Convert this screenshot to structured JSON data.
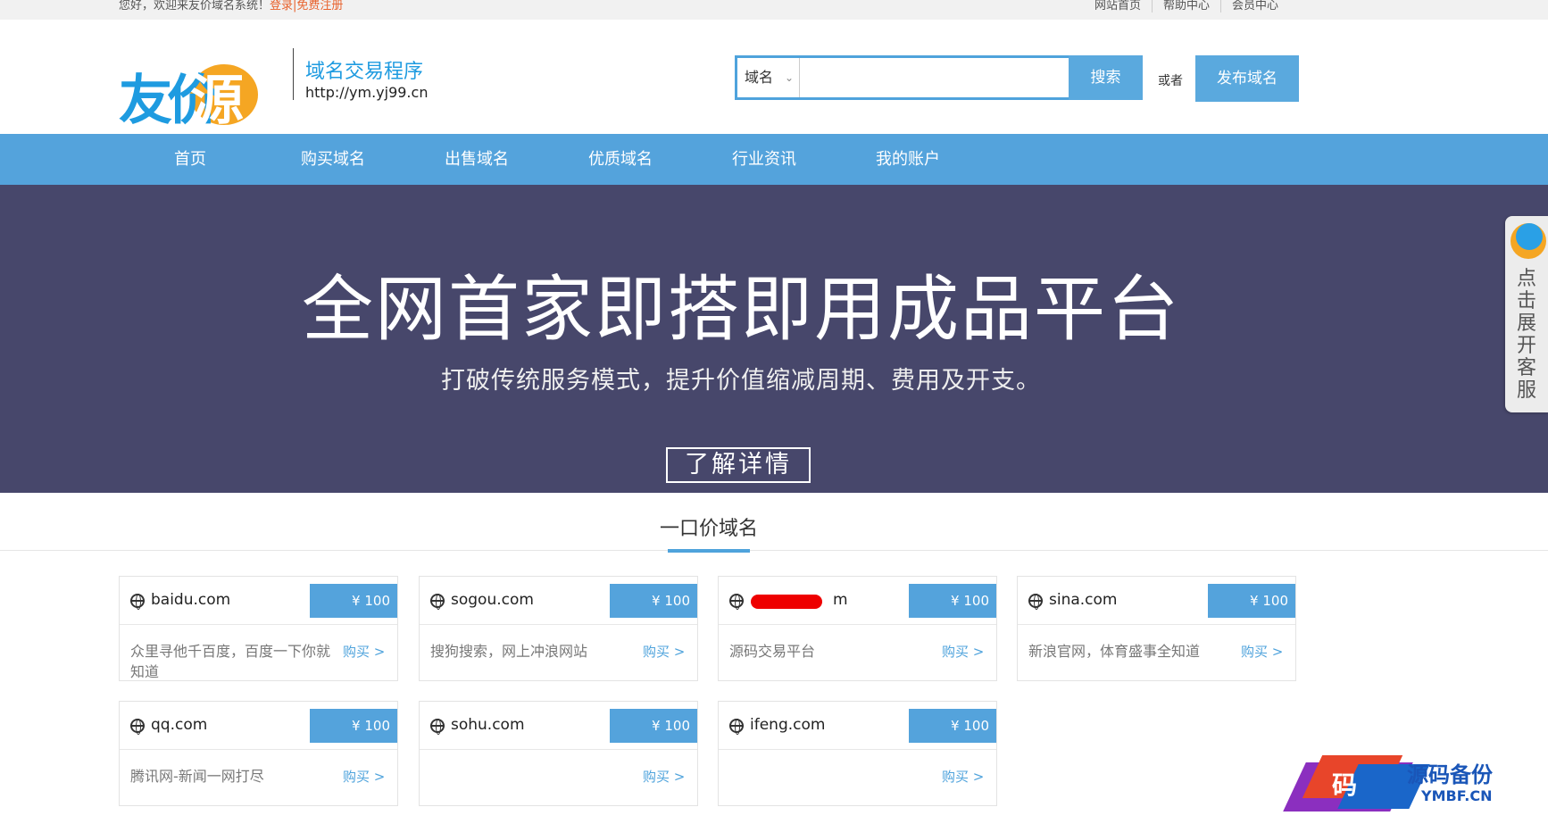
{
  "topbar": {
    "welcome": "您好，欢迎来友价域名系统！",
    "login": "登录",
    "sep": "|",
    "register": "免费注册",
    "links": [
      "网站首页",
      "帮助中心",
      "会员中心"
    ]
  },
  "header": {
    "logo_text_a": "友价",
    "logo_text_b": "源码",
    "logo_sub": "域名交易程序",
    "logo_url": "http://ym.yj99.cn",
    "search_select": "域名",
    "search_value": "",
    "search_button": "搜索",
    "or_text": "或者",
    "publish_button": "发布域名"
  },
  "nav": [
    "首页",
    "购买域名",
    "出售域名",
    "优质域名",
    "行业资讯",
    "我的账户"
  ],
  "banner": {
    "title": "全网首家即搭即用成品平台",
    "subtitle": "打破传统服务模式，提升价值缩减周期、费用及开支。",
    "button": "了解详情"
  },
  "side_tab": {
    "text": "点击展开客服"
  },
  "section": {
    "title": "一口价域名"
  },
  "cards": [
    {
      "domain": "baidu.com",
      "price": "¥ 100",
      "desc": "众里寻他千百度，百度一下你就知道",
      "buy": "购买 >"
    },
    {
      "domain": "sogou.com",
      "price": "¥ 100",
      "desc": "搜狗搜索，网上冲浪网站",
      "buy": "购买 >"
    },
    {
      "domain": "m",
      "price": "¥ 100",
      "desc": "源码交易平台",
      "buy": "购买 >"
    },
    {
      "domain": "sina.com",
      "price": "¥ 100",
      "desc": "新浪官网，体育盛事全知道",
      "buy": "购买 >"
    },
    {
      "domain": "qq.com",
      "price": "¥ 100",
      "desc": "腾讯网-新闻一网打尽",
      "buy": "购买 >"
    },
    {
      "domain": "sohu.com",
      "price": "¥ 100",
      "desc": "",
      "buy": "购买 >"
    },
    {
      "domain": "ifeng.com",
      "price": "¥ 100",
      "desc": "",
      "buy": "购买 >"
    }
  ],
  "watermark": {
    "mark": "码",
    "title": "源码备份",
    "url": "YMBF.CN"
  },
  "colors": {
    "accent": "#54a3dc",
    "banner_bg": "#47476b",
    "link_orange": "#e8612c",
    "logo_blue": "#1e9be0",
    "logo_orange": "#f5a623"
  }
}
